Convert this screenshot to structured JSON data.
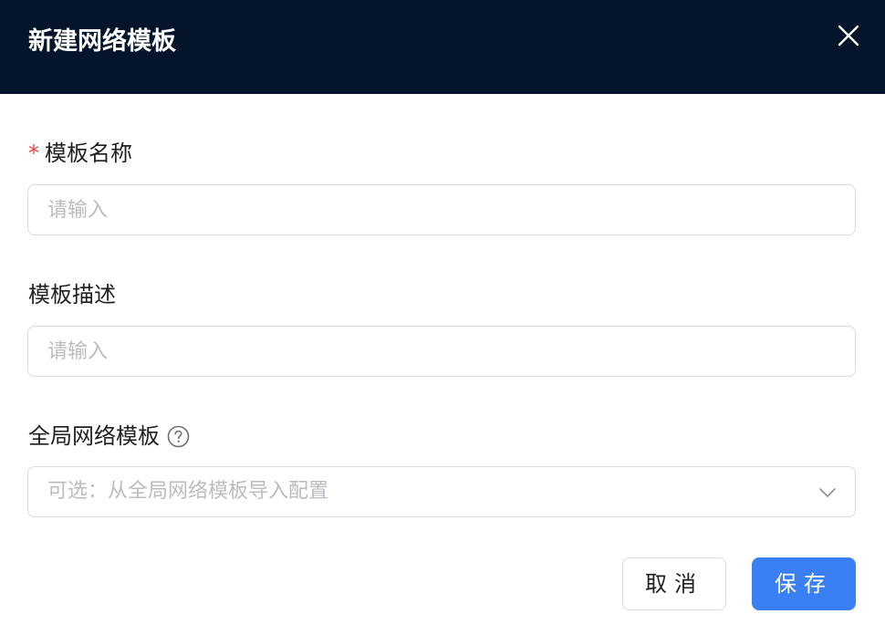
{
  "dialog": {
    "title": "新建网络模板"
  },
  "form": {
    "name": {
      "required_mark": "*",
      "label": "模板名称",
      "placeholder": "请输入",
      "value": ""
    },
    "description": {
      "label": "模板描述",
      "placeholder": "请输入",
      "value": ""
    },
    "global_template": {
      "label": "全局网络模板",
      "placeholder": "可选：从全局网络模板导入配置"
    }
  },
  "footer": {
    "cancel_label": "取消",
    "save_label": "保存"
  },
  "icons": {
    "close": "close-icon",
    "help": "question-circle-icon",
    "dropdown": "chevron-down-icon"
  },
  "colors": {
    "header_bg": "#04152b",
    "primary": "#3b7ff5",
    "required": "#f0433b",
    "border": "#d7dbe3",
    "placeholder": "#b9bcc2"
  }
}
